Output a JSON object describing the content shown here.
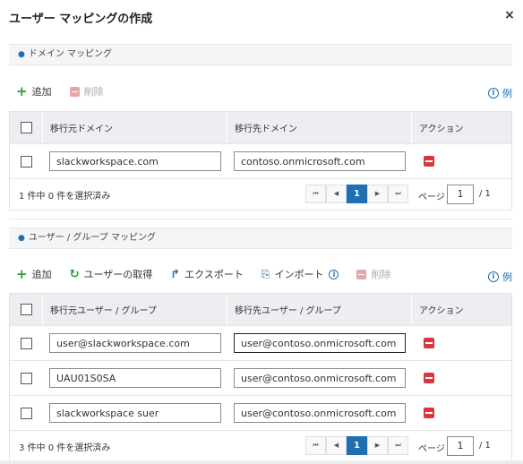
{
  "dialog": {
    "title": "ユーザー マッピングの作成",
    "close_label": "×"
  },
  "domain_section": {
    "title": "ドメイン マッピング",
    "toolbar": {
      "add": "追加",
      "delete": "削除"
    },
    "example": "例",
    "columns": {
      "source": "移行元ドメイン",
      "destination": "移行先ドメイン",
      "action": "アクション"
    },
    "rows": [
      {
        "source": "slackworkspace.com",
        "destination": "contoso.onmicrosoft.com"
      }
    ],
    "footer": {
      "summary": "1 件中 0 件を選択済み",
      "page_label": "ページ",
      "page": "1",
      "total": "/ 1",
      "current": "1"
    }
  },
  "user_section": {
    "title": "ユーザー / グループ マッピング",
    "toolbar": {
      "add": "追加",
      "fetch": "ユーザーの取得",
      "export": "エクスポート",
      "import": "インポート",
      "delete": "削除"
    },
    "example": "例",
    "columns": {
      "source": "移行元ユーザー / グループ",
      "destination": "移行先ユーザー / グループ",
      "action": "アクション"
    },
    "rows": [
      {
        "source": "user@slackworkspace.com",
        "destination": "user@contoso.onmicrosoft.com"
      },
      {
        "source": "UAU01S0SA",
        "destination": "user@contoso.onmicrosoft.com"
      },
      {
        "source": "slackworkspace suer",
        "destination": "user@contoso.onmicrosoft.com"
      }
    ],
    "footer": {
      "summary": "3 件中 0 件を選択済み",
      "page_label": "ページ",
      "page": "1",
      "total": "/ 1",
      "current": "1"
    }
  },
  "pager_icons": {
    "first": "⏮",
    "prev": "◀",
    "next": "▶",
    "last": "⏭"
  },
  "colors": {
    "accent": "#1f6fb2",
    "add_green": "#2e9d3a",
    "delete_red": "#d9363e"
  }
}
